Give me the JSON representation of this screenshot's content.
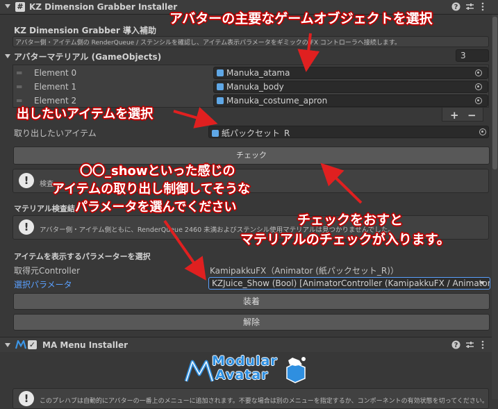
{
  "installer": {
    "title": "KZ Dimension Grabber Installer",
    "help_section_title": "KZ Dimension Grabber 導入補助",
    "help_text": "アバター側・アイテム側の RenderQueue / ステンシルを確認し、アイテム表示パラメータをギミックの FX コントローラへ接続します。",
    "materials_label": "アバターマテリアル (GameObjects)",
    "materials_count": "3",
    "elements": [
      {
        "label": "Element 0",
        "value": "Manuka_atama"
      },
      {
        "label": "Element 1",
        "value": "Manuka_body"
      },
      {
        "label": "Element 2",
        "value": "Manuka_costume_apron"
      }
    ],
    "add_label": "+",
    "remove_label": "−",
    "item_label": "取り出したいアイテム",
    "item_value": "紙パックセット_R",
    "check_button": "チェック",
    "check_help": "検査",
    "material_check_title": "マテリアル検査結",
    "material_check_text": "アバター側・アイテム側ともに、RenderQueue 2460 未満およびステンシル使用マテリアルは見つかりませんでした。",
    "param_section_title": "アイテムを表示するパラメーターを選択",
    "controller_label": "取得元Controller",
    "controller_value": "KamipakkuFX（Animator (紙パックセット_R)）",
    "param_label": "選択パラメータ",
    "param_value": "KZJuice_Show  (Bool)  [AnimatorController (KamipakkuFX / Animator",
    "install_button": "装着",
    "uninstall_button": "解除"
  },
  "ma": {
    "title": "MA Menu Installer",
    "logo_top": "Modular",
    "logo_bottom": "Avatar",
    "footer_text": "このプレハブは自動的にアバターの一番上のメニューに追加されます。不要な場合は別のメニューを指定するか、コンポーネントの有効状態を切ってください。"
  },
  "annotations": {
    "a1": "アバターの主要なゲームオブジェクトを選択",
    "a2": "出したいアイテムを選択",
    "a3_line1": "〇〇_showといった感じの",
    "a3_line2": "アイテムの取り出し制御してそうな",
    "a3_line3": "パラメータを選んでください",
    "a4_line1": "チェックをおすと",
    "a4_line2": "マテリアルのチェックが入ります。"
  },
  "colors": {
    "accent_link": "#5aa0ff",
    "annotation_red": "#e02020",
    "ma_logo": "#2f8fe0"
  }
}
